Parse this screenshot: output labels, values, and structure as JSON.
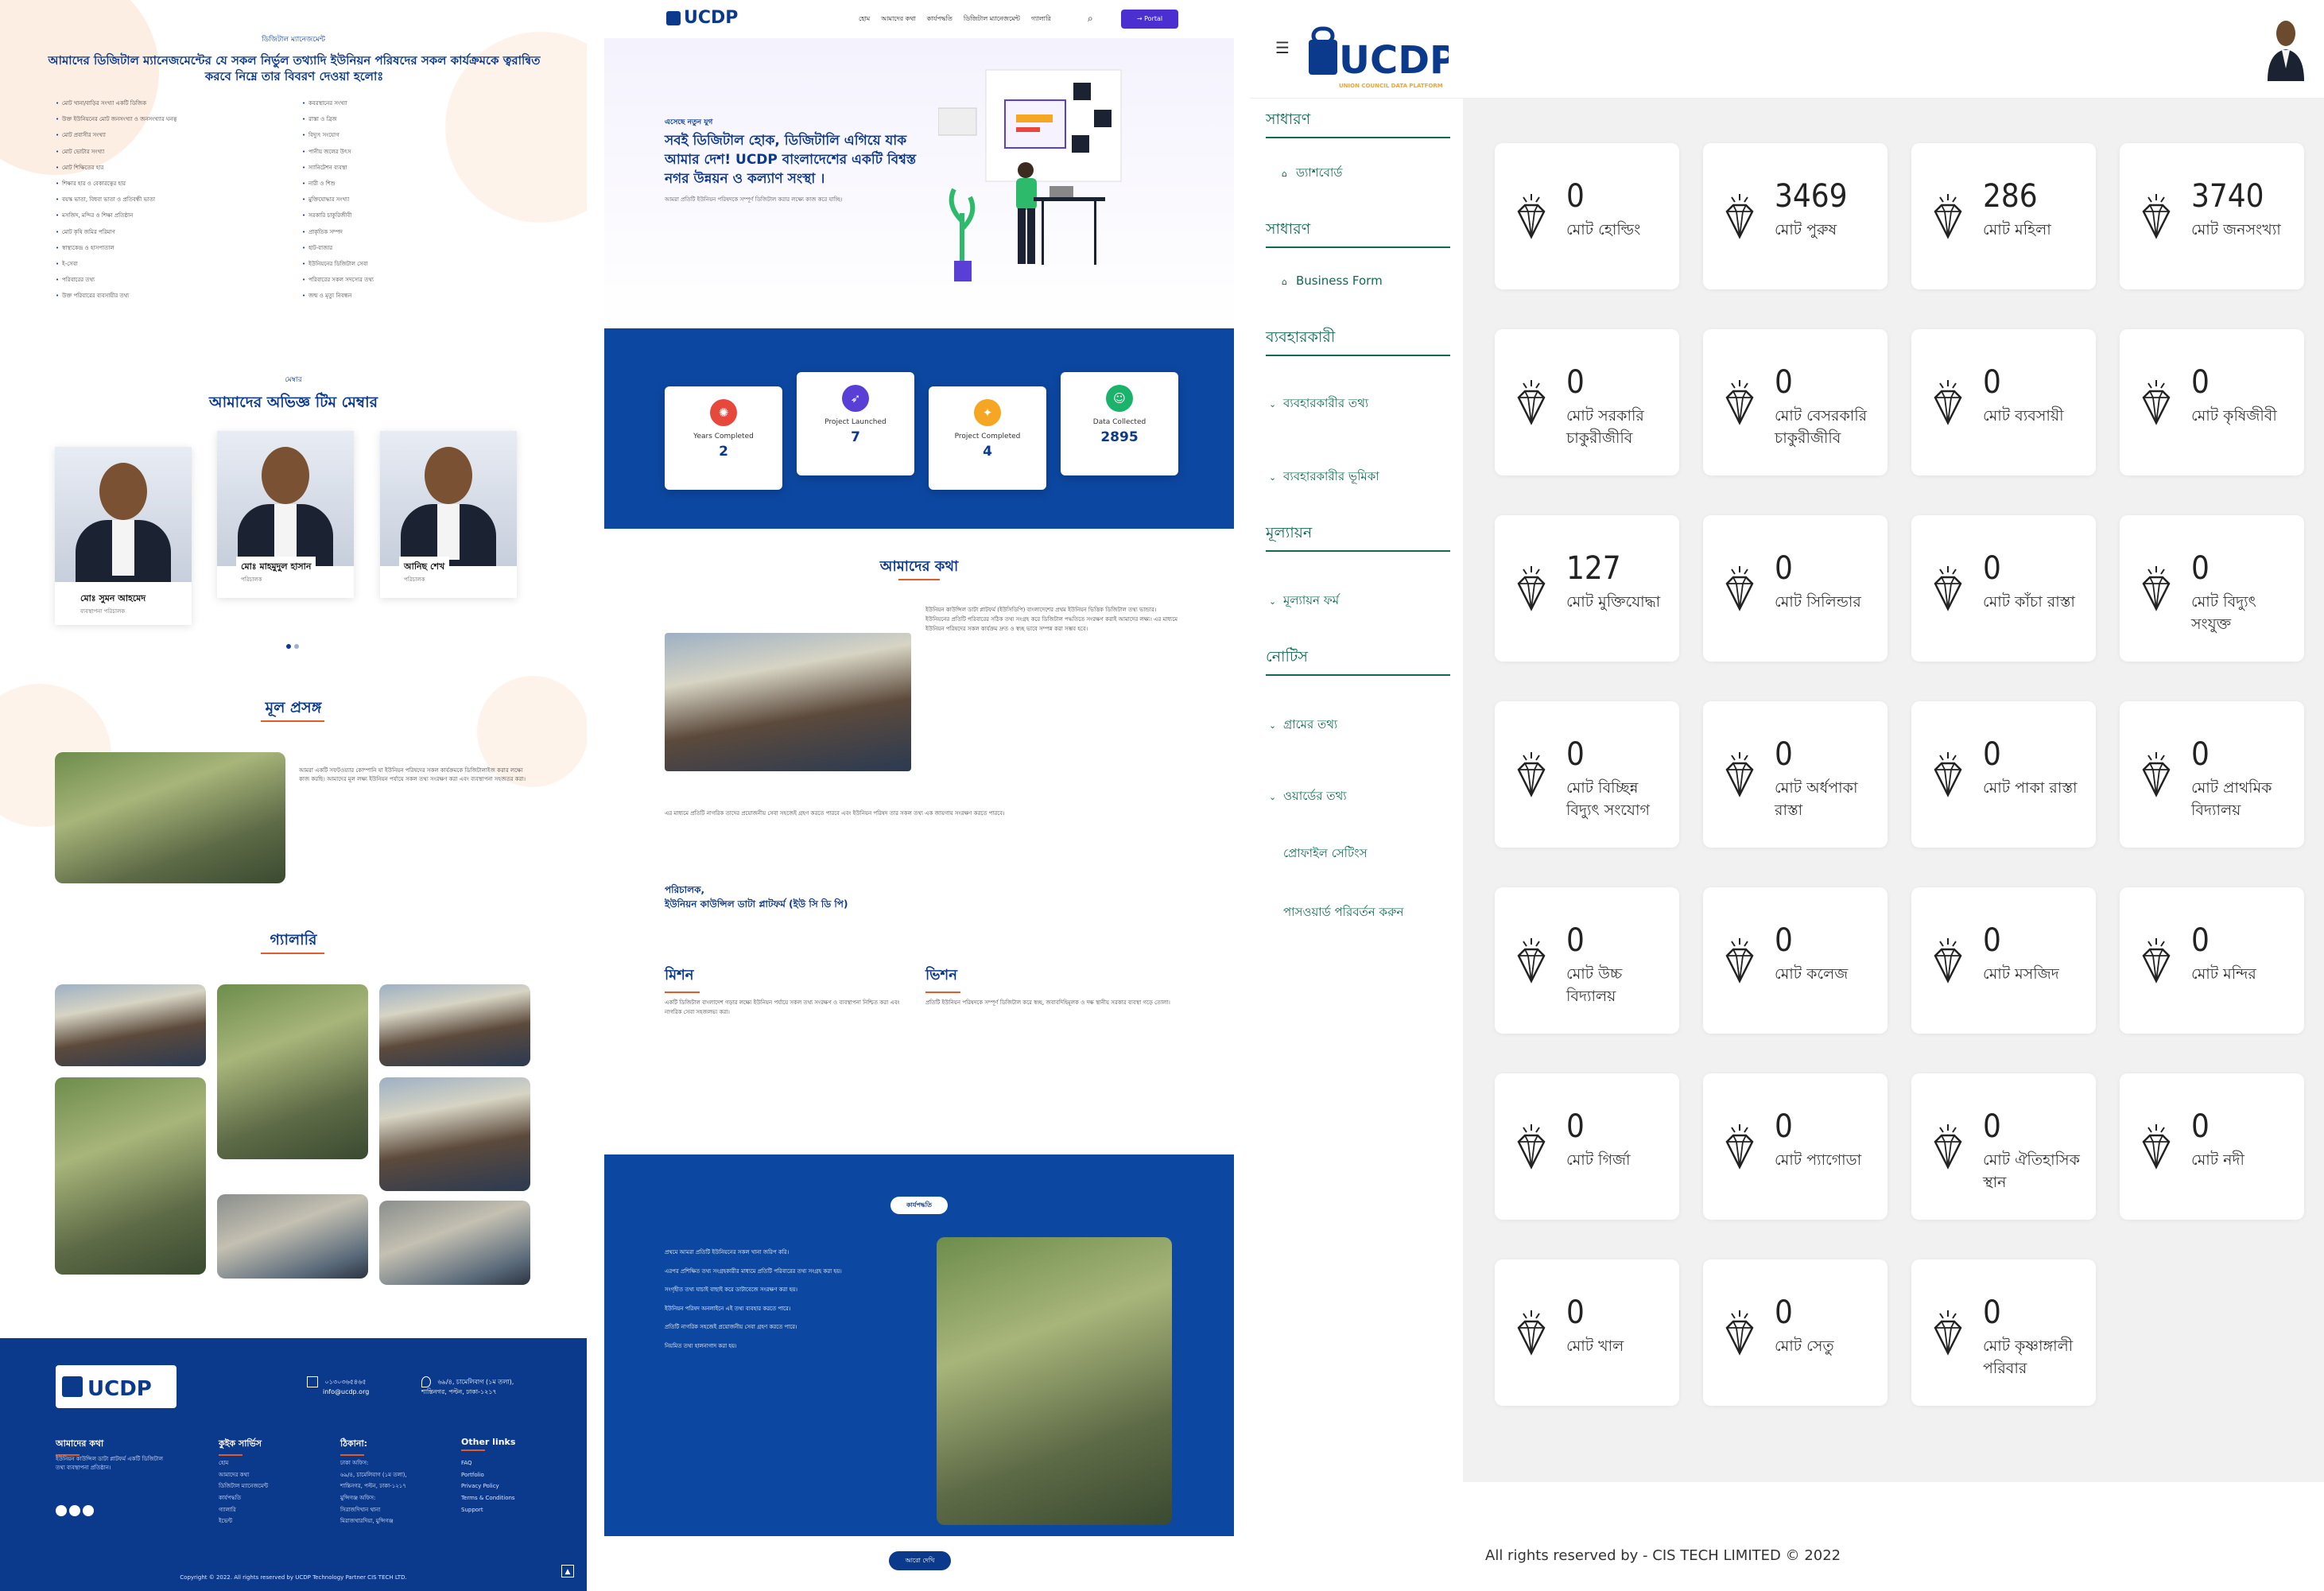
{
  "panel1": {
    "top_label": "ডিজিটাল ম্যানেজমেন্ট",
    "heading": "আমাদের ডিজিটাল ম্যানেজমেন্টের যে সকল নির্ভুল তথ্যাদি ইউনিয়ন পরিষদের সকল কার্যক্রমকে ত্বরান্বিত করবে নিম্নে তার বিবরণ দেওয়া হলোঃ",
    "bullets_left": [
      "মোট খানা/বাড়ির সংখ্যা একটি ডিজিক",
      "উক্ত ইউনিয়নের মোট জনসংখ্যা ও জনসংখ্যার ঘনত্ব",
      "মোট প্রবাসীর সংখ্যা",
      "মোট ভোটার সংখ্যা",
      "মোট শিক্ষিতের হার",
      "শিক্ষার হার ও বেকারত্বের হার",
      "বয়স্ক ভাতা, বিধবা ভাতা ও প্রতিবন্ধী ভাতা",
      "মসজিদ, মন্দির ও শিক্ষা প্রতিষ্ঠান",
      "মোট কৃষি জমির পরিমাণ",
      "স্বাস্থ্যকেন্দ্র ও হাসপাতাল",
      "ই-সেবা",
      "পরিবারের তথ্য",
      "উক্ত পরিবারের ব্যবসায়ীর তথ্য"
    ],
    "bullets_right": [
      "কবরস্থানের সংখ্যা",
      "রাস্তা ও ব্রিজ",
      "বিদ্যুৎ সংযোগ",
      "পানীয় জলের উৎস",
      "স্যানিটেশন ব্যবস্থা",
      "নারী ও শিশু",
      "মুক্তিযোদ্ধার সংখ্যা",
      "সরকারি চাকুরিজীবী",
      "প্রাকৃতিক সম্পদ",
      "হাট-বাজার",
      "ইউনিয়নের ডিজিটাল সেবা",
      "পরিবারের সকল সদস্যের তথ্য",
      "জন্ম ও মৃত্যু নিবন্ধন"
    ],
    "team_label": "মেম্বার",
    "team_title": "আমাদের অভিজ্ঞ টিম মেম্বার",
    "team": [
      {
        "name": "মোঃ সুমন আহমেদ",
        "role": "ব্যবস্থাপনা পরিচালক"
      },
      {
        "name": "মোঃ মাহমুদুল হাসান",
        "role": "পরিচালক"
      },
      {
        "name": "আনিছ শেখ",
        "role": "পরিচালক"
      }
    ],
    "topic_title": "মূল প্রসঙ্গ",
    "topic_text": "আমরা একটি সফটওয়্যার কোম্পানি যা ইউনিয়ন পরিষদের সকল কার্যক্রমকে ডিজিটালাইজ করার লক্ষ্যে কাজ করছি। আমাদের মূল লক্ষ্য ইউনিয়ন পর্যায়ে সকল তথ্য সংরক্ষণ করা এবং ব্যবস্থাপনা সহজতর করা।",
    "gallery_title": "গ্যালারি",
    "footer": {
      "phone": "০১৩০৩৬৫৪৬৫",
      "email": "info@ucdp.org",
      "address": "৬৯/৪, চামেলিবাগ (১ম তলা), শান্তিনগর, পল্টন, ঢাকা-১২১৭",
      "about_title": "আমাদের কথা",
      "about_text": "ইউনিয়ন কাউন্সিল ডাটা প্লাটফর্ম একটি ডিজিটাল তথ্য ব্যবস্থাপনা প্রতিষ্ঠান।",
      "quick_title": "কুইক সার্ভিস",
      "quick_links": [
        "হোম",
        "আমাদের কথা",
        "ডিজিটাল ম্যানেজমেন্ট",
        "কার্যপদ্ধতি",
        "গ্যালারি",
        "ইভেন্ট"
      ],
      "address_title": "ঠিকানা:",
      "address_lines": [
        "ঢাকা অফিস:",
        "৬৯/৪, চামেলিবাগ (১ম তলা),",
        "শান্তিনগর, পল্টন, ঢাকা-১২১৭",
        "মুন্সিগঞ্জ অফিস:",
        "সিরাজদিখান থানা",
        "মিরাজখারদিয়া, মুন্সিগঞ্জ"
      ],
      "other_title": "Other links",
      "other_links": [
        "FAQ",
        "Portfolio",
        "Privacy Policy",
        "Terms & Conditions",
        "Support"
      ],
      "copyright": "Copyright © 2022. All rights reserved by UCDP Technology Partner CIS TECH LTD."
    }
  },
  "panel2": {
    "logo": "UCDP",
    "menu": [
      "হোম",
      "আমাদের কথা",
      "কার্যপদ্ধতি",
      "ডিজিটাল ম্যানেজমেন্ট",
      "গ্যালারি"
    ],
    "portal": "→ Portal",
    "hero_kicker": "এসেছে নতুন যুগ",
    "hero_title": "সবই ডিজিটাল হোক, ডিজিটালি এগিয়ে যাক আমার দেশ! UCDP বাংলাদেশের একটি বিশ্বস্ত নগর উন্নয়ন ও কল্যাণ সংস্থা ।",
    "hero_sub": "আমরা প্রতিটি ইউনিয়ন পরিষদকে সম্পূর্ণ ডিজিটাল করার লক্ষ্যে কাজ করে যাচ্ছি।",
    "stats": [
      {
        "label": "Years Completed",
        "value": "2",
        "color": "#e8473c",
        "icon": "✺"
      },
      {
        "label": "Project Launched",
        "value": "7",
        "color": "#5a3fd6",
        "icon": "➶"
      },
      {
        "label": "Project Completed",
        "value": "4",
        "color": "#f5a623",
        "icon": "✦"
      },
      {
        "label": "Data Collected",
        "value": "2895",
        "color": "#1bb26b",
        "icon": "☺"
      }
    ],
    "about_title": "আমাদের কথা",
    "about_text": "ইউনিয়ন কাউন্সিল ডাটা প্লাটফর্ম (ইউসিডিপি) বাংলাদেশের প্রথম ইউনিয়ন ভিত্তিক ডিজিটাল তথ্য ভান্ডার। ইউনিয়নের প্রতিটি পরিবারের সঠিক তথ্য সংগ্রহ করে ডিজিটাল পদ্ধতিতে সংরক্ষণ করাই আমাদের লক্ষ্য। এর মাধ্যমে ইউনিয়ন পরিষদের সকল কার্যক্রম দ্রুত ও স্বচ্ছ ভাবে সম্পন্ন করা সম্ভব হবে।",
    "about_text2": "এর মাধ্যমে প্রতিটি নাগরিক তাদের প্রয়োজনীয় সেবা সহজেই গ্রহণ করতে পারবে এবং ইউনিয়ন পরিষদ তার সকল তথ্য এক জায়গায় সংরক্ষণ করতে পারবে।",
    "signature": [
      "পরিচালক,",
      "ইউনিয়ন কাউন্সিল ডাটা প্লাটফর্ম (ইউ সি ডি পি)"
    ],
    "mission_title": "মিশন",
    "mission_text": "একটি ডিজিটাল বাংলাদেশ গড়ার লক্ষ্যে ইউনিয়ন পর্যায়ে সকল তথ্য সংরক্ষণ ও ব্যবস্থাপনা নিশ্চিত করা এবং নাগরিক সেবা সহজলভ্য করা।",
    "vision_title": "ভিশন",
    "vision_text": "প্রতিটি ইউনিয়ন পরিষদকে সম্পূর্ণ ডিজিটাল করে স্বচ্ছ, জবাবদিহিমূলক ও দক্ষ স্থানীয় সরকার ব্যবস্থা গড়ে তোলা।",
    "work_label": "কার্যপদ্ধতি",
    "work_items": [
      "প্রথমে আমরা প্রতিটি ইউনিয়নের সকল খানা জরিপ করি।",
      "এরপর প্রশিক্ষিত তথ্য সংগ্রহকারীর মাধ্যমে প্রতিটি পরিবারের তথ্য সংগ্রহ করা হয়।",
      "সংগৃহীত তথ্য যাচাই বাছাই করে ডাটাবেজে সংরক্ষণ করা হয়।",
      "ইউনিয়ন পরিষদ অনলাইনে এই তথ্য ব্যবহার করতে পারে।",
      "প্রতিটি নাগরিক সহজেই প্রয়োজনীয় সেবা গ্রহণ করতে পারে।",
      "নিয়মিত তথ্য হালনাগাদ করা হয়।"
    ],
    "more_btn": "আরো দেখি"
  },
  "panel3": {
    "logo_text": "UCDP",
    "logo_sub": "UNION COUNCIL DATA PLATFORM",
    "sidebar": {
      "groups": [
        {
          "title": "সাধারণ"
        },
        {
          "title": "সাধারণ"
        },
        {
          "title": "ব্যবহারকারী"
        },
        {
          "title": "মূল্যায়ন"
        },
        {
          "title": "নোটিস"
        }
      ],
      "items": [
        {
          "label": "ড্যাশবোর্ড",
          "icon": "⌂"
        },
        {
          "label": "Business Form",
          "icon": "⌂"
        },
        {
          "label": "ব্যবহারকারীর তথ্য",
          "icon": "⌄"
        },
        {
          "label": "ব্যবহারকারীর ভূমিকা",
          "icon": "⌄"
        },
        {
          "label": "মূল্যায়ন ফর্ম",
          "icon": "⌄"
        },
        {
          "label": "গ্রামের তথ্য",
          "icon": "⌄"
        },
        {
          "label": "ওয়ার্ডের তথ্য",
          "icon": "⌄"
        },
        {
          "label": "প্রোফাইল সেটিংস",
          "icon": ""
        },
        {
          "label": "পাসওয়ার্ড পরিবর্তন করুন",
          "icon": ""
        }
      ]
    },
    "tiles": [
      {
        "value": "0",
        "label": "মোট হোল্ডিং"
      },
      {
        "value": "3469",
        "label": "মোট পুরুষ"
      },
      {
        "value": "286",
        "label": "মোট মহিলা"
      },
      {
        "value": "3740",
        "label": "মোট জনসংখ্যা"
      },
      {
        "value": "0",
        "label": "মোট সরকারি চাকুরীজীবি"
      },
      {
        "value": "0",
        "label": "মোট বেসরকারি চাকুরীজীবি"
      },
      {
        "value": "0",
        "label": "মোট ব্যবসায়ী"
      },
      {
        "value": "0",
        "label": "মোট কৃষিজীবী"
      },
      {
        "value": "127",
        "label": "মোট মুক্তিযোদ্ধা"
      },
      {
        "value": "0",
        "label": "মোট সিলিন্ডার"
      },
      {
        "value": "0",
        "label": "মোট কাঁচা রাস্তা"
      },
      {
        "value": "0",
        "label": "মোট বিদ্যুৎ সংযুক্ত"
      },
      {
        "value": "0",
        "label": "মোট বিচ্ছিন্ন বিদ্যুৎ সংযোগ"
      },
      {
        "value": "0",
        "label": "মোট অর্ধপাকা রাস্তা"
      },
      {
        "value": "0",
        "label": "মোট পাকা রাস্তা"
      },
      {
        "value": "0",
        "label": "মোট প্রাথমিক বিদ্যালয়"
      },
      {
        "value": "0",
        "label": "মোট উচ্চ বিদ্যালয়"
      },
      {
        "value": "0",
        "label": "মোট কলেজ"
      },
      {
        "value": "0",
        "label": "মোট মসজিদ"
      },
      {
        "value": "0",
        "label": "মোট মন্দির"
      },
      {
        "value": "0",
        "label": "মোট গির্জা"
      },
      {
        "value": "0",
        "label": "মোট প্যাগোডা"
      },
      {
        "value": "0",
        "label": "মোট ঐতিহাসিক স্থান"
      },
      {
        "value": "0",
        "label": "মোট নদী"
      },
      {
        "value": "0",
        "label": "মোট খাল"
      },
      {
        "value": "0",
        "label": "মোট সেতু"
      },
      {
        "value": "0",
        "label": "মোট কৃষ্ণাঙ্গালী পরিবার"
      }
    ],
    "footer": "All rights reserved by - CIS TECH LIMITED © 2022"
  }
}
